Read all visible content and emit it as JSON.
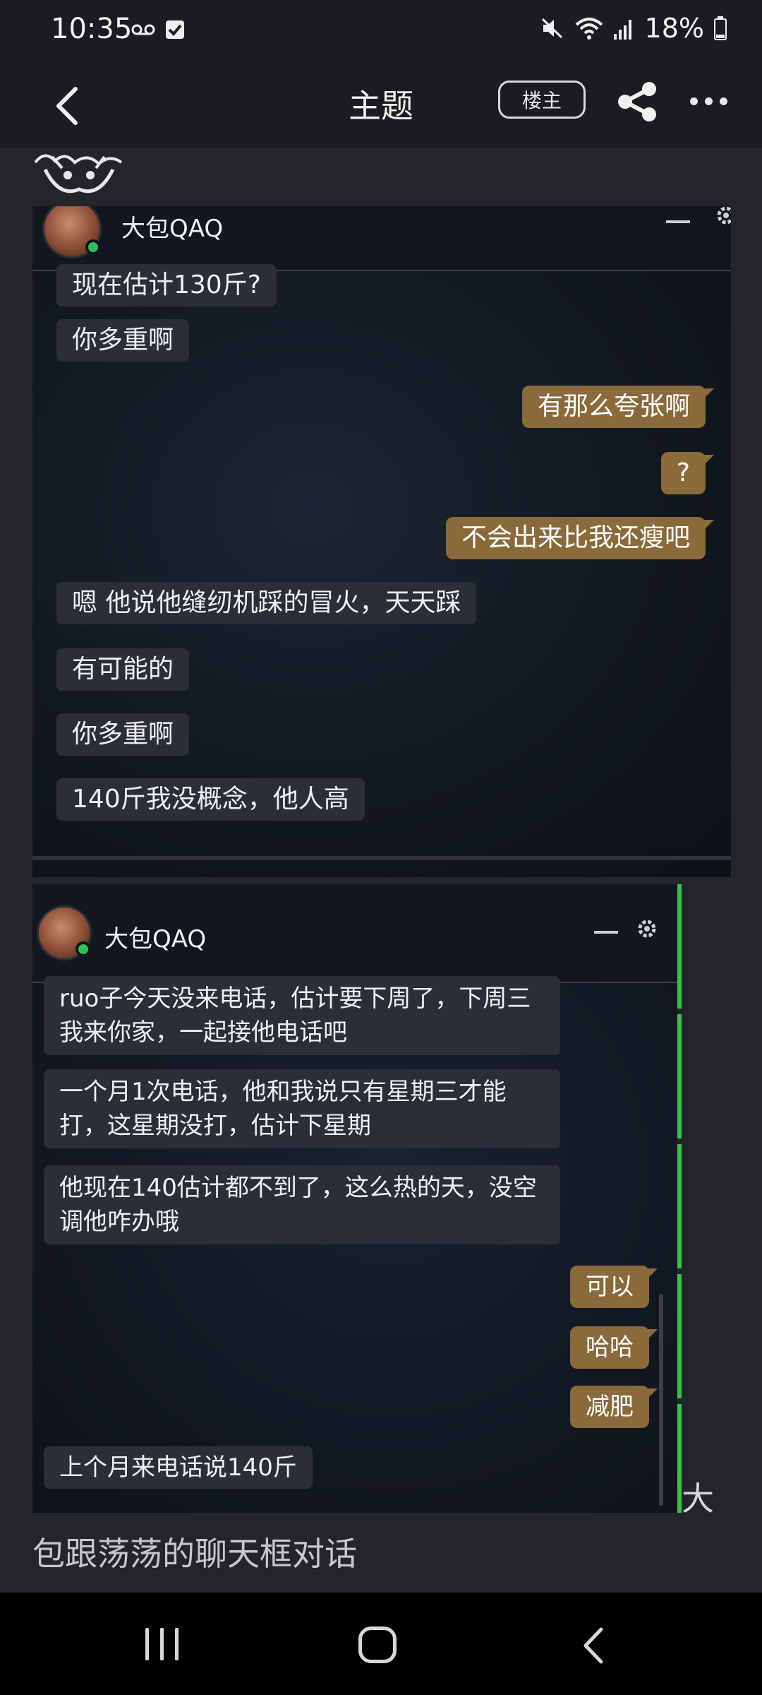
{
  "status_bar": {
    "time": "10:35",
    "battery": "18%",
    "icons": [
      "voicemail-icon",
      "checkbox-icon",
      "mute-icon",
      "wifi-icon",
      "signal-icon",
      "battery-icon"
    ]
  },
  "app_bar": {
    "title": "主题",
    "owner_button": "楼主",
    "icons": [
      "back-icon",
      "share-icon",
      "more-icon"
    ]
  },
  "screenshot_1": {
    "contact_name": "大包QAQ",
    "messages": [
      {
        "text": "现在估计130斤?",
        "side": "in"
      },
      {
        "text": "你多重啊",
        "side": "in"
      },
      {
        "text": "有那么夸张啊",
        "side": "out"
      },
      {
        "text": "?",
        "side": "out"
      },
      {
        "text": "不会出来比我还瘦吧",
        "side": "out"
      },
      {
        "text": "嗯 他说他缝纫机踩的冒火，天天踩",
        "side": "in"
      },
      {
        "text": "有可能的",
        "side": "in"
      },
      {
        "text": "你多重啊",
        "side": "in"
      },
      {
        "text": "140斤我没概念，他人高",
        "side": "in"
      }
    ]
  },
  "screenshot_2": {
    "contact_name": "大包QAQ",
    "messages": [
      {
        "text": "ruo子今天没来电话，估计要下周了，下周三我来你家，一起接他电话吧",
        "side": "in"
      },
      {
        "text": "一个月1次电话，他和我说只有星期三才能打，这星期没打，估计下星期",
        "side": "in"
      },
      {
        "text": "他现在140估计都不到了，这么热的天，没空调他咋办哦",
        "side": "in"
      },
      {
        "text": "可以",
        "side": "out"
      },
      {
        "text": "哈哈",
        "side": "out"
      },
      {
        "text": "减肥",
        "side": "out"
      },
      {
        "text": "上个月来电话说140斤",
        "side": "in"
      }
    ]
  },
  "post": {
    "trailing_char": "大",
    "caption": "包跟荡荡的聊天框对话"
  },
  "nav_bar": {
    "icons": [
      "recent-apps-icon",
      "home-icon",
      "back-nav-icon"
    ]
  },
  "colors": {
    "background": "#23252b",
    "bar": "#1b1c20",
    "incoming_bubble": "#2a2e36",
    "outgoing_bubble": "#8a6a3b",
    "online_dot": "#2fbf5a",
    "quote_bar": "#3fbe4a"
  }
}
